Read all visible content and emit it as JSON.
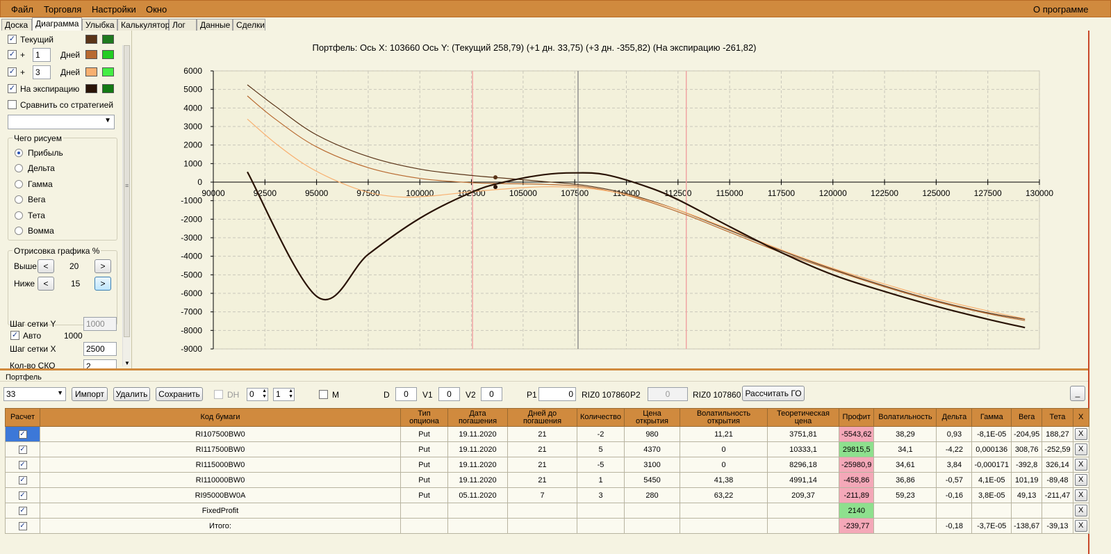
{
  "menu": [
    "Файл",
    "Торговля",
    "Настройки",
    "Окно"
  ],
  "menu_about": "О программе",
  "tabs": [
    "Доска",
    "Диаграмма",
    "Улыбка",
    "Калькулятор",
    "Лог",
    "Данные",
    "Сделки"
  ],
  "active_tab": "Диаграмма",
  "left": {
    "current_label": "Текущий",
    "plus1_prefix": "+",
    "plus1_days": "1",
    "plus1_unit": "Дней",
    "plus3_prefix": "+",
    "plus3_days": "3",
    "plus3_unit": "Дней",
    "expiry_label": "На экспирацию",
    "compare_label": "Сравнить со стратегией",
    "draw_group_title": "Чего рисуем",
    "radios": [
      "Прибыль",
      "Дельта",
      "Гамма",
      "Вега",
      "Тета",
      "Вомма"
    ],
    "render_group_title": "Отрисовка графика %",
    "above_label": "Выше",
    "above_value": "20",
    "below_label": "Ниже",
    "below_value": "15",
    "prev_label": "<",
    "next_label": ">",
    "grid_y_label": "Шаг сетки Y",
    "grid_y_value": "1000",
    "auto_label": "Авто",
    "auto_value": "1000",
    "grid_x_label": "Шаг сетки X",
    "grid_x_value": "2500",
    "sko_label": "Кол-во СКО",
    "sko_value": "2"
  },
  "colors": {
    "current": "#5a3418",
    "current_base": "#1f7a1f",
    "plus1": "#b86a30",
    "plus1_base": "#22cc22",
    "plus3": "#f8b070",
    "plus3_base": "#44ee44",
    "expiry": "#2a1406",
    "expiry_base": "#137a13",
    "header": "#d08a3e"
  },
  "chart_data": {
    "type": "line",
    "title": "Портфель: Ось X: 103660 Ось Y: (Текущий 258,79) (+1 дн. 33,75) (+3 дн. -355,82) (На экспирацию -261,82)",
    "xlim": [
      90000,
      130000
    ],
    "ylim": [
      -9000,
      6000
    ],
    "x_ticks": [
      90000,
      92500,
      95000,
      97500,
      100000,
      102500,
      105000,
      107500,
      110000,
      112500,
      115000,
      117500,
      120000,
      122500,
      125000,
      127500,
      130000
    ],
    "y_ticks": [
      6000,
      5000,
      4000,
      3000,
      2000,
      1000,
      0,
      -1000,
      -2000,
      -3000,
      -4000,
      -5000,
      -6000,
      -7000,
      -8000,
      -9000
    ],
    "grid": true,
    "vlines": [
      {
        "x": 102550,
        "color": "#f0a0a0"
      },
      {
        "x": 107660,
        "color": "#8a8a8a"
      },
      {
        "x": 112900,
        "color": "#f0a0a0"
      }
    ],
    "series": [
      {
        "color": "#5a3418",
        "width": 1.2,
        "x": [
          91650,
          93000,
          95000,
          97500,
          100000,
          102500,
          104000,
          106000,
          108000,
          110000,
          112500,
          115000,
          117500,
          120000,
          122500,
          125000,
          127500,
          129300
        ],
        "y": [
          5250,
          4100,
          2550,
          1380,
          700,
          360,
          220,
          30,
          -180,
          -620,
          -1500,
          -2600,
          -3700,
          -4700,
          -5600,
          -6400,
          -7050,
          -7400
        ]
      },
      {
        "color": "#b86a30",
        "width": 1.2,
        "x": [
          91650,
          93000,
          95000,
          97500,
          100000,
          102500,
          104000,
          106000,
          108000,
          110000,
          112500,
          115000,
          117500,
          120000,
          122500,
          125000,
          127500,
          129300
        ],
        "y": [
          4650,
          3400,
          1900,
          780,
          200,
          -30,
          -80,
          -120,
          -250,
          -700,
          -1600,
          -2700,
          -3800,
          -4750,
          -5650,
          -6450,
          -7100,
          -7470
        ]
      },
      {
        "color": "#f8b070",
        "width": 1.2,
        "x": [
          91650,
          93000,
          94500,
          96000,
          97500,
          99000,
          100500,
          102500,
          104000,
          106000,
          108000,
          110000,
          112500,
          115000,
          117500,
          120000,
          122500,
          125000,
          127500,
          129300
        ],
        "y": [
          3400,
          2100,
          900,
          50,
          -550,
          -800,
          -750,
          -520,
          -380,
          -250,
          -320,
          -680,
          -1500,
          -2550,
          -3650,
          -4650,
          -5500,
          -6300,
          -6950,
          -7370
        ]
      },
      {
        "color": "#2a1406",
        "width": 2.2,
        "x": [
          91650,
          95050,
          97500,
          100000,
          102500,
          104000,
          106000,
          107500,
          109000,
          111000,
          112500,
          115000,
          117500,
          120000,
          122500,
          125000,
          127500,
          129300
        ],
        "y": [
          550,
          -6200,
          -3900,
          -1950,
          -550,
          -20,
          400,
          500,
          400,
          -250,
          -950,
          -2400,
          -3800,
          -5000,
          -5900,
          -6700,
          -7400,
          -7850
        ]
      }
    ],
    "markers": [
      {
        "x": 103660,
        "y": 259,
        "color": "#5a3418"
      },
      {
        "x": 103660,
        "y": -262,
        "color": "#2a1406"
      }
    ]
  },
  "portfolio": {
    "title": "Портфель",
    "selected": "33",
    "import_label": "Импорт",
    "delete_label": "Удалить",
    "save_label": "Сохранить",
    "dh_label": "DH",
    "dh_a": "0",
    "dh_b": "1",
    "m_label": "M",
    "d_label": "D",
    "d_value": "0",
    "v1_label": "V1",
    "v1_value": "0",
    "v2_label": "V2",
    "v2_value": "0",
    "p1_label": "P1",
    "p1_value": "0",
    "p1_info": "RIZ0 107860",
    "p2_label": "P2",
    "p2_value": "0",
    "p2_info": "RIZ0 107860",
    "calc_go_label": "Рассчитать ГО",
    "min_label": "_"
  },
  "table": {
    "headers": [
      "Расчет",
      "Код бумаги",
      "Тип\nопциона",
      "Дата\nпогашения",
      "Дней до\nпогашения",
      "Количество",
      "Цена\nоткрытия",
      "Волатильность\nоткрытия",
      "Теоретическая\nцена",
      "Профит",
      "Волатильность",
      "Дельта",
      "Гамма",
      "Вега",
      "Тета",
      "X"
    ],
    "rows": [
      [
        "RI107500BW0",
        "Put",
        "19.11.2020",
        "21",
        "-2",
        "980",
        "11,21",
        "3751,81",
        "-5543,62",
        "38,29",
        "0,93",
        "-8,1E-05",
        "-204,95",
        "188,27"
      ],
      [
        "RI117500BW0",
        "Put",
        "19.11.2020",
        "21",
        "5",
        "4370",
        "0",
        "10333,1",
        "29815,5",
        "34,1",
        "-4,22",
        "0,000136",
        "308,76",
        "-252,59"
      ],
      [
        "RI115000BW0",
        "Put",
        "19.11.2020",
        "21",
        "-5",
        "3100",
        "0",
        "8296,18",
        "-25980,9",
        "34,61",
        "3,84",
        "-0,000171",
        "-392,8",
        "326,14"
      ],
      [
        "RI110000BW0",
        "Put",
        "19.11.2020",
        "21",
        "1",
        "5450",
        "41,38",
        "4991,14",
        "-458,86",
        "36,86",
        "-0,57",
        "4,1E-05",
        "101,19",
        "-89,48"
      ],
      [
        "RI95000BW0A",
        "Put",
        "05.11.2020",
        "7",
        "3",
        "280",
        "63,22",
        "209,37",
        "-211,89",
        "59,23",
        "-0,16",
        "3,8E-05",
        "49,13",
        "-211,47"
      ],
      [
        "FixedProfit",
        "",
        "",
        "",
        "",
        "",
        "",
        "",
        "2140",
        "",
        "",
        "",
        "",
        ""
      ],
      [
        "Итого:",
        "",
        "",
        "",
        "",
        "",
        "",
        "",
        "-239,77",
        "",
        "-0,18",
        "-3,7E-05",
        "-138,67",
        "-39,13"
      ]
    ],
    "profit_status": [
      "red",
      "green",
      "red",
      "red",
      "red",
      "green",
      "red"
    ],
    "x_label": "X"
  }
}
